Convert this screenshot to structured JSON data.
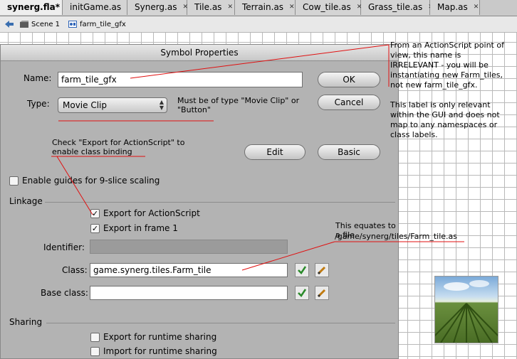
{
  "tabs": [
    {
      "label": "synerg.fla*",
      "active": true
    },
    {
      "label": "initGame.as",
      "active": false
    },
    {
      "label": "Synerg.as",
      "active": false
    },
    {
      "label": "Tile.as",
      "active": false
    },
    {
      "label": "Terrain.as",
      "active": false
    },
    {
      "label": "Cow_tile.as",
      "active": false
    },
    {
      "label": "Grass_tile.as",
      "active": false
    },
    {
      "label": "Map.as",
      "active": false
    }
  ],
  "breadcrumb": {
    "scene": "Scene 1",
    "symbol": "farm_tile_gfx"
  },
  "dialog": {
    "title": "Symbol Properties",
    "name_label": "Name:",
    "name_value": "farm_tile_gfx",
    "type_label": "Type:",
    "type_value": "Movie Clip",
    "ok_label": "OK",
    "cancel_label": "Cancel",
    "edit_label": "Edit",
    "basic_label": "Basic",
    "guides_label": "Enable guides for 9-slice scaling",
    "linkage_label": "Linkage",
    "export_as_label": "Export for ActionScript",
    "export_frame_label": "Export in frame 1",
    "identifier_label": "Identifier:",
    "class_label": "Class:",
    "class_value": "game.synerg.tiles.Farm_tile",
    "base_class_label": "Base class:",
    "sharing_label": "Sharing",
    "runtime_export_label": "Export for runtime sharing",
    "runtime_import_label": "Import for runtime sharing"
  },
  "annotations": {
    "type_note": "Must be of type \"Movie Clip\" or \"Button\"",
    "check_note": "Check \"Export for ActionScript\" to enable class binding",
    "file_note_1": "This equates to a file",
    "file_note_2": "/game/synerg/tiles/Farm_tile.as",
    "right_1": "From an ActionScript point of view, this name is IRRELEVANT - you will be instantiating new Farm_tiles, not new farm_tile_gfx.",
    "right_2": "This label is only relevant within the GUI and does not map to any namespaces or class labels."
  },
  "icons": [
    "back-arrow-icon",
    "scene-icon",
    "symbol-icon",
    "checkmark-icon",
    "pencil-icon"
  ],
  "colors": {
    "annotation_line": "#e01010",
    "dialog_bg": "#b3b3b3"
  }
}
